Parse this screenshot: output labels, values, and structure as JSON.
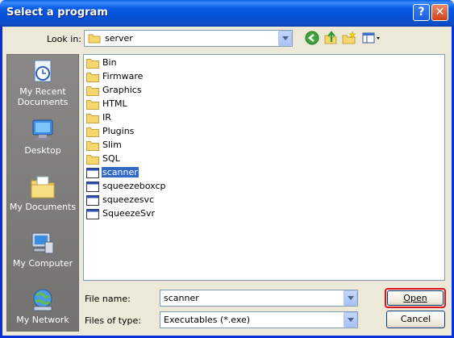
{
  "window": {
    "title": "Select a program"
  },
  "titlebar_buttons": {
    "help": "?",
    "close": "✕"
  },
  "look_in": {
    "label": "Look in:",
    "value": "server"
  },
  "toolbar": {
    "icons": [
      "back-icon",
      "up-folder-icon",
      "new-folder-icon",
      "view-menu-icon"
    ]
  },
  "places": [
    {
      "label": "My Recent Documents",
      "icon": "recent-documents-icon"
    },
    {
      "label": "Desktop",
      "icon": "desktop-icon"
    },
    {
      "label": "My Documents",
      "icon": "my-documents-icon"
    },
    {
      "label": "My Computer",
      "icon": "my-computer-icon"
    },
    {
      "label": "My Network",
      "icon": "my-network-icon"
    }
  ],
  "files": [
    {
      "name": "Bin",
      "type": "folder",
      "selected": false
    },
    {
      "name": "Firmware",
      "type": "folder",
      "selected": false
    },
    {
      "name": "Graphics",
      "type": "folder",
      "selected": false
    },
    {
      "name": "HTML",
      "type": "folder",
      "selected": false
    },
    {
      "name": "IR",
      "type": "folder",
      "selected": false
    },
    {
      "name": "Plugins",
      "type": "folder",
      "selected": false
    },
    {
      "name": "Slim",
      "type": "folder",
      "selected": false
    },
    {
      "name": "SQL",
      "type": "folder",
      "selected": false
    },
    {
      "name": "scanner",
      "type": "exe",
      "selected": true
    },
    {
      "name": "squeezeboxcp",
      "type": "exe",
      "selected": false
    },
    {
      "name": "squeezesvc",
      "type": "exe",
      "selected": false
    },
    {
      "name": "SqueezeSvr",
      "type": "exe",
      "selected": false
    }
  ],
  "file_name": {
    "label": "File name:",
    "value": "scanner"
  },
  "files_of_type": {
    "label": "Files of type:",
    "value": "Executables (*.exe)"
  },
  "buttons": {
    "open": "Open",
    "cancel": "Cancel"
  }
}
